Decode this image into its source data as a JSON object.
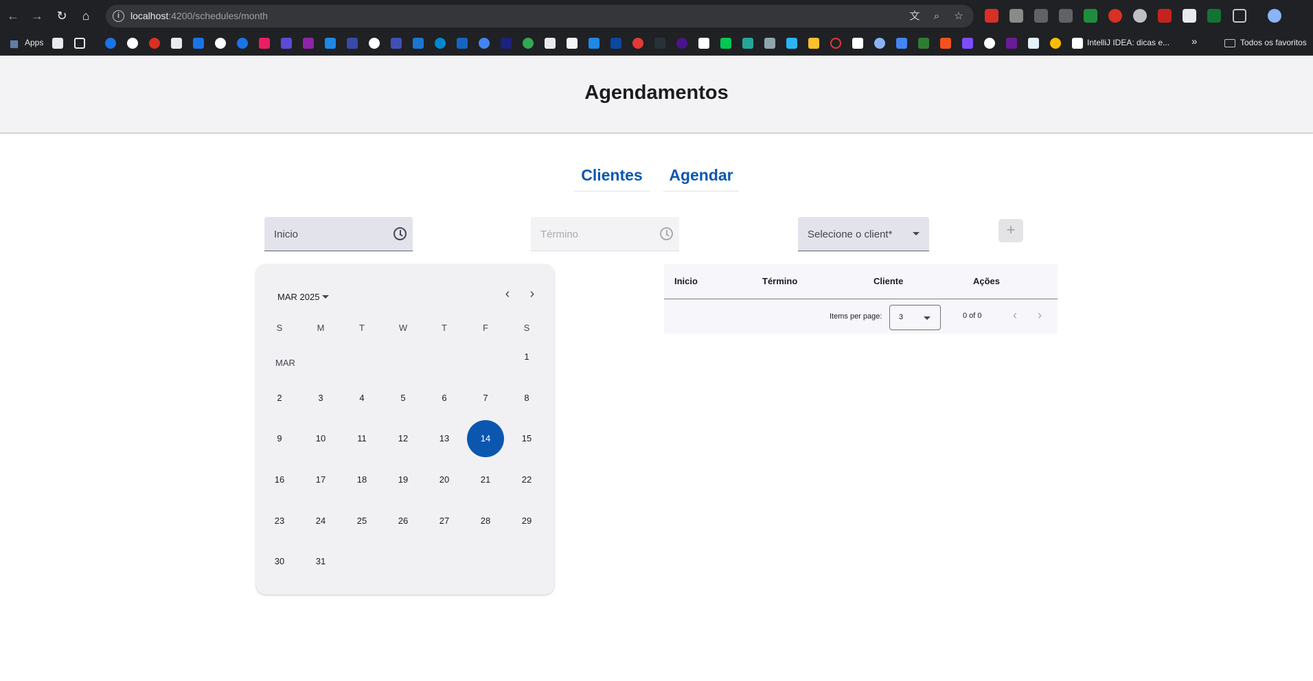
{
  "browser": {
    "url_host": "localhost",
    "url_rest": ":4200/schedules/month",
    "bookmarks_apps_label": "Apps",
    "bookmark_intellij_label": "IntelliJ IDEA: dicas e...",
    "bookmarks_overflow": "»",
    "all_bookmarks_label": "Todos os favoritos"
  },
  "header": {
    "title": "Agendamentos"
  },
  "tabs": [
    {
      "label": "Clientes"
    },
    {
      "label": "Agendar"
    }
  ],
  "form": {
    "start_label": "Inicio",
    "end_label": "Término",
    "client_label": "Selecione o client*",
    "add_symbol": "+"
  },
  "calendar": {
    "period": "MAR 2025",
    "month_label": "MAR",
    "weekdays": [
      "S",
      "M",
      "T",
      "W",
      "T",
      "F",
      "S"
    ],
    "days": [
      "1",
      "2",
      "3",
      "4",
      "5",
      "6",
      "7",
      "8",
      "9",
      "10",
      "11",
      "12",
      "13",
      "14",
      "15",
      "16",
      "17",
      "18",
      "19",
      "20",
      "21",
      "22",
      "23",
      "24",
      "25",
      "26",
      "27",
      "28",
      "29",
      "30",
      "31"
    ],
    "selected_day": "14"
  },
  "table": {
    "headers": [
      "Inicio",
      "Término",
      "Cliente",
      "Ações"
    ],
    "items_per_page_label": "Items per page:",
    "items_per_page_value": "3",
    "range_label": "0 of 0"
  },
  "colors": {
    "accent": "#0b57b0",
    "chrome_bg": "#202124",
    "header_bg": "#f3f3f5"
  }
}
